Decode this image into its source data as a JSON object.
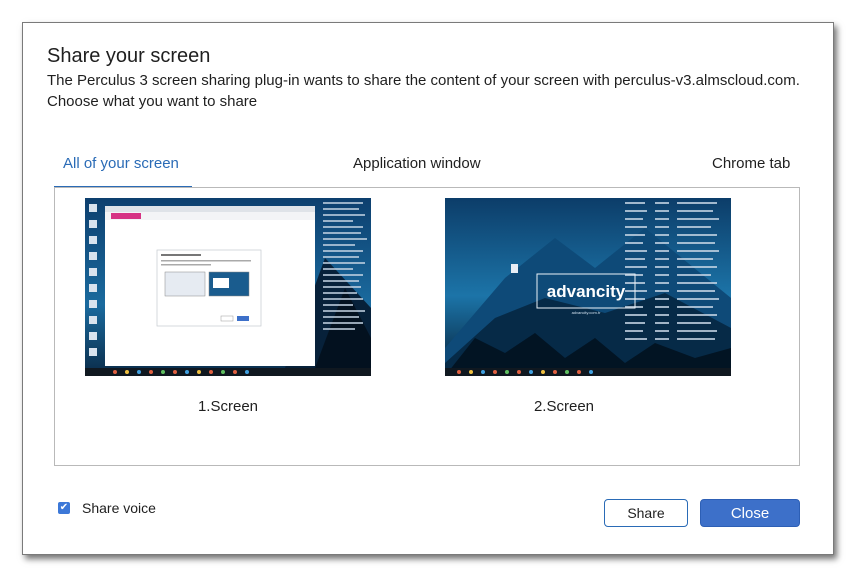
{
  "dialog": {
    "title": "Share your screen",
    "message_line1": "The Perculus 3 screen sharing plug-in wants to share the content of your screen with perculus-v3.almscloud.com.",
    "message_line2": "Choose what you want to share"
  },
  "tabs": [
    {
      "label": "All of your screen",
      "active": true
    },
    {
      "label": "Application window",
      "active": false
    },
    {
      "label": "Chrome tab",
      "active": false
    }
  ],
  "screens": [
    {
      "label": "1.Screen"
    },
    {
      "label": "2.Screen",
      "logo_text": "advancity",
      "logo_subtext": "advancity.com.tr"
    }
  ],
  "share_voice": {
    "label": "Share voice",
    "checked": true
  },
  "buttons": {
    "share": "Share",
    "close": "Close"
  },
  "colors": {
    "accent": "#2a6bb6",
    "close_button": "#3d70c9",
    "desktop_sky": "#0f4d80"
  }
}
